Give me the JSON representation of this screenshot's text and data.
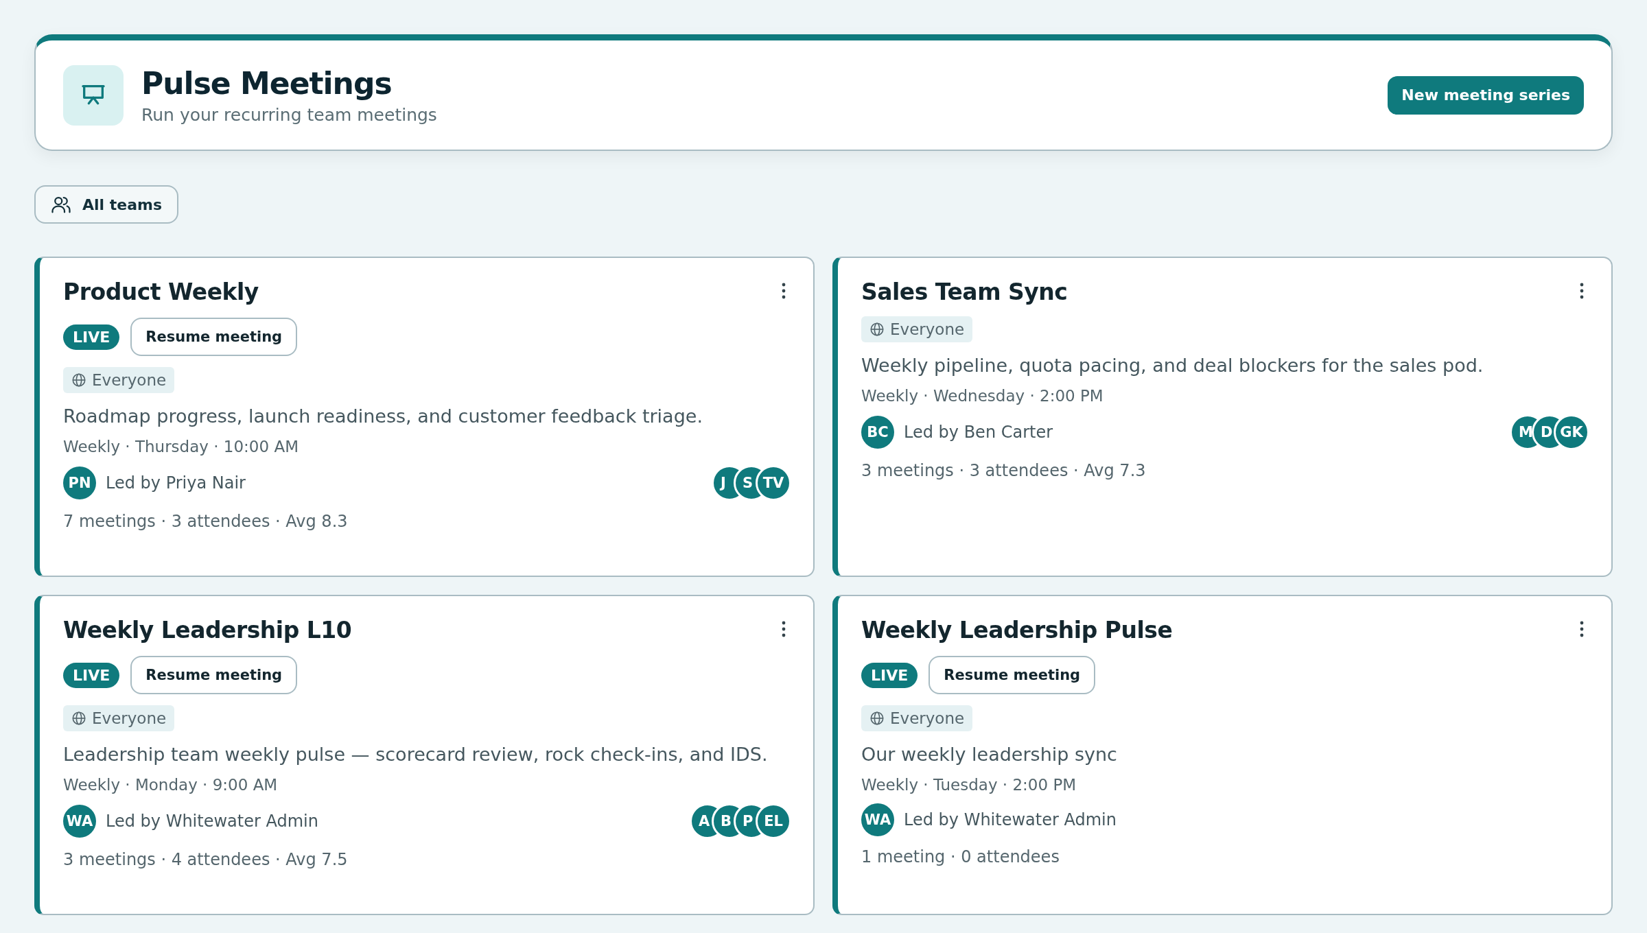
{
  "header": {
    "title": "Pulse Meetings",
    "subtitle": "Run your recurring team meetings",
    "action": "New meeting series"
  },
  "filter": {
    "label": "All teams"
  },
  "series": [
    {
      "title": "Product Weekly",
      "live": true,
      "live_label": "LIVE",
      "resume": "Resume meeting",
      "audience": "Everyone",
      "description": "Roadmap progress, launch readiness, and customer feedback triage.",
      "schedule": "Weekly · Thursday · 10:00 AM",
      "lead_initials": "PN",
      "lead": "Led by Priya Nair",
      "attendees": [
        "J",
        "S",
        "TV"
      ],
      "stats": "7 meetings · 3 attendees · Avg 8.3"
    },
    {
      "title": "Sales Team Sync",
      "live": false,
      "audience": "Everyone",
      "description": "Weekly pipeline, quota pacing, and deal blockers for the sales pod.",
      "schedule": "Weekly · Wednesday · 2:00 PM",
      "lead_initials": "BC",
      "lead": "Led by Ben Carter",
      "attendees": [
        "M",
        "D",
        "GK"
      ],
      "stats": "3 meetings · 3 attendees · Avg 7.3"
    },
    {
      "title": "Weekly Leadership L10",
      "live": true,
      "live_label": "LIVE",
      "resume": "Resume meeting",
      "audience": "Everyone",
      "description": "Leadership team weekly pulse — scorecard review, rock check-ins, and IDS.",
      "schedule": "Weekly · Monday · 9:00 AM",
      "lead_initials": "WA",
      "lead": "Led by Whitewater Admin",
      "attendees": [
        "A",
        "B",
        "P",
        "EL"
      ],
      "stats": "3 meetings · 4 attendees · Avg 7.5"
    },
    {
      "title": "Weekly Leadership Pulse",
      "live": true,
      "live_label": "LIVE",
      "resume": "Resume meeting",
      "audience": "Everyone",
      "description": "Our weekly leadership sync",
      "schedule": "Weekly · Tuesday · 2:00 PM",
      "lead_initials": "WA",
      "lead": "Led by Whitewater Admin",
      "stats": "1 meeting · 0 attendees"
    }
  ]
}
